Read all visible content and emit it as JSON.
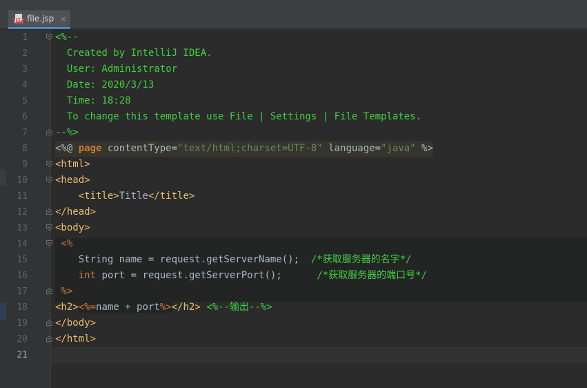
{
  "tab": {
    "icon": "jsp-file-icon",
    "icon_badge": "JSP",
    "label": "file.jsp",
    "close": "×"
  },
  "lines": [
    {
      "n": "1",
      "t": {
        "a": "<%--"
      }
    },
    {
      "n": "2",
      "t": {
        "a": "  Created by IntelliJ IDEA."
      }
    },
    {
      "n": "3",
      "t": {
        "a": "  User: Administrator"
      }
    },
    {
      "n": "4",
      "t": {
        "a": "  Date: 2020/3/13"
      }
    },
    {
      "n": "5",
      "t": {
        "a": "  Time: 18:28"
      }
    },
    {
      "n": "6",
      "t": {
        "a": "  To change this template use File | Settings | File Templates."
      }
    },
    {
      "n": "7",
      "t": {
        "a": "--%>"
      }
    },
    {
      "n": "8",
      "t": {
        "a": "<%@ ",
        "b": "page",
        "c": " contentType=",
        "d": "\"text/html;charset=UTF-8\"",
        "e": " language=",
        "f": "\"java\"",
        "g": " %>"
      }
    },
    {
      "n": "9",
      "t": {
        "a": "<html>"
      }
    },
    {
      "n": "10",
      "t": {
        "a": "<head>"
      }
    },
    {
      "n": "11",
      "t": {
        "a": "    <title>",
        "b": "Title",
        "c": "</title>"
      }
    },
    {
      "n": "12",
      "t": {
        "a": "</head>"
      }
    },
    {
      "n": "13",
      "t": {
        "a": "<body>"
      }
    },
    {
      "n": "14",
      "t": {
        "a": " <%"
      }
    },
    {
      "n": "15",
      "t": {
        "a": "    String name = request.getServerName();  ",
        "b": "/*获取服务器的名字*/"
      }
    },
    {
      "n": "16",
      "t": {
        "a": "    ",
        "b": "int",
        "c": " port = request.getServerPort();      ",
        "d": "/*获取服务器的端口号*/"
      }
    },
    {
      "n": "17",
      "t": {
        "a": " %>"
      }
    },
    {
      "n": "18",
      "t": {
        "a": "<h2>",
        "b": "<%=",
        "c": "name + port",
        "d": "%>",
        "e": "</h2>",
        "f": " ",
        "g": "<%--输出--%>"
      }
    },
    {
      "n": "19",
      "t": {
        "a": "</body>"
      }
    },
    {
      "n": "20",
      "t": {
        "a": "</html>"
      }
    },
    {
      "n": "21",
      "t": {
        "a": ""
      }
    }
  ],
  "colors": {
    "background": "#2b2b2b",
    "gutter": "#313335",
    "comment": "#40d040",
    "tag": "#e8bf6a",
    "keyword": "#cc7832",
    "string": "#6a8759",
    "text": "#a9b7c6",
    "accent": "#4a88c7"
  }
}
